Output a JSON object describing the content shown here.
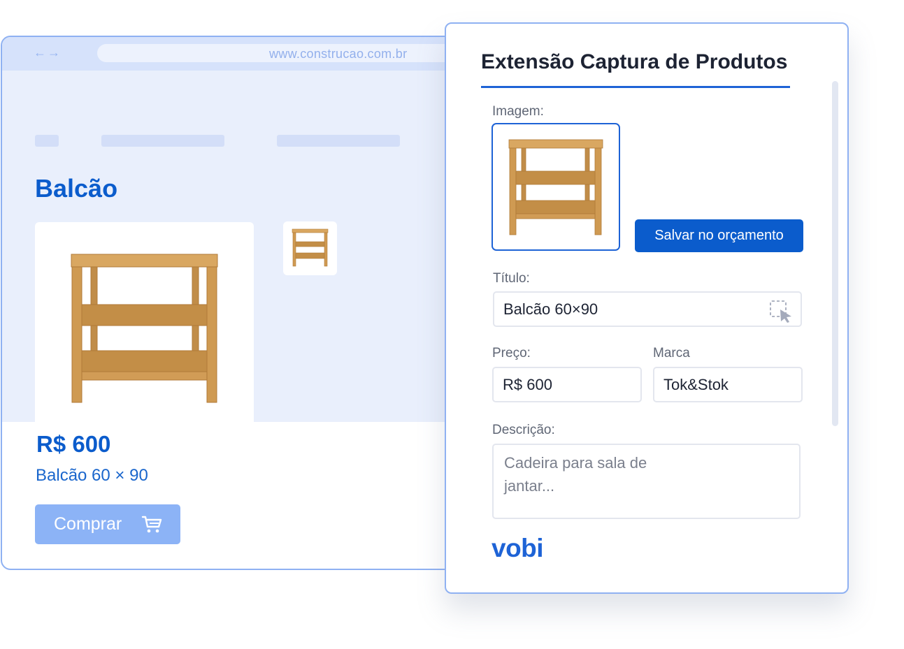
{
  "browser": {
    "url": "www.construcao.com.br",
    "nav_arrows": "←→",
    "product": {
      "title": "Balcão",
      "price": "R$ 600",
      "subtitle": "Balcão 60 × 90",
      "buy_label": "Comprar"
    }
  },
  "extension": {
    "title": "Extensão Captura de Produtos",
    "image_label": "Imagem:",
    "save_button": "Salvar no orçamento",
    "title_label": "Título:",
    "title_value": "Balcão 60×90",
    "price_label": "Preço:",
    "price_value": "R$ 600",
    "brand_label": "Marca",
    "brand_value": "Tok&Stok",
    "description_label": "Descrição:",
    "description_placeholder": "Cadeira para sala de\njantar...",
    "logo": "vobi"
  },
  "colors": {
    "accent": "#0b5ccc",
    "button_disabled": "#8cb3f6",
    "panel_border": "#8fb1f2",
    "page_bg": "#e9effc"
  },
  "icons": [
    "back-forward-arrows-icon",
    "shopping-cart-icon",
    "select-cursor-icon",
    "wooden-shelf-image"
  ]
}
